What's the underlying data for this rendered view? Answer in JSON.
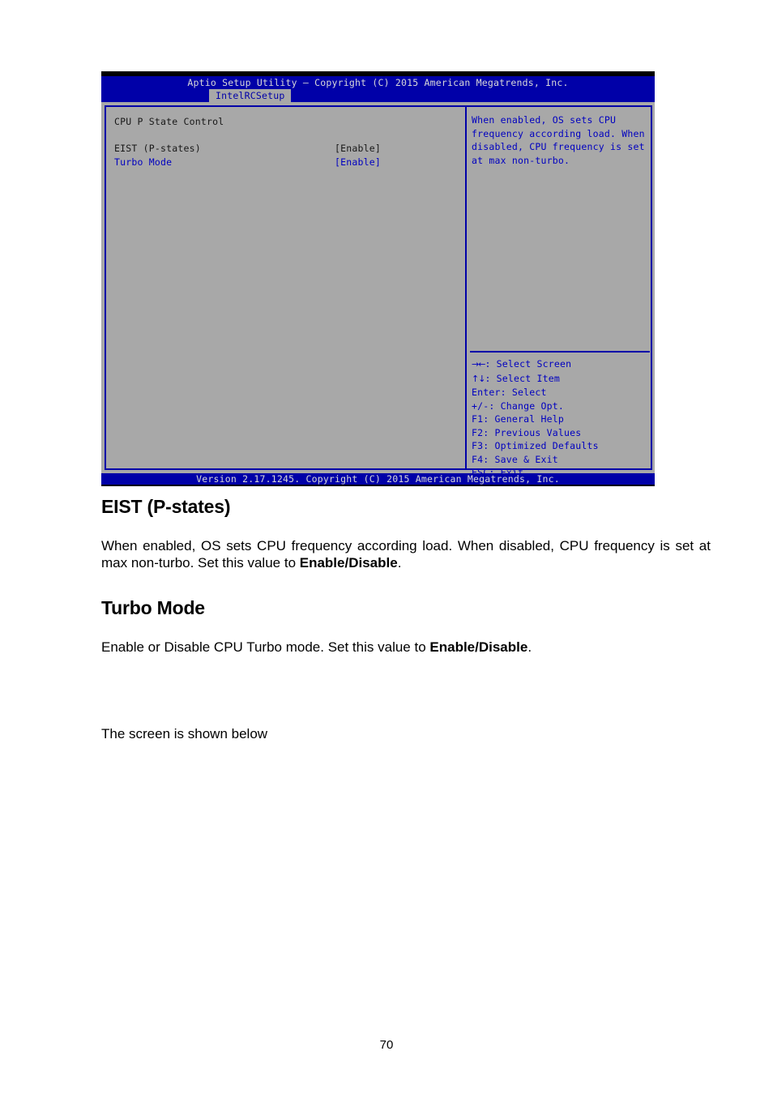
{
  "bios": {
    "title": "Aptio Setup Utility – Copyright (C) 2015 American Megatrends, Inc.",
    "tab": "IntelRCSetup",
    "section_header": "CPU P State Control",
    "options": [
      {
        "label": "EIST (P-states)",
        "value": "[Enable]",
        "selected": false
      },
      {
        "label": "Turbo Mode",
        "value": "[Enable]",
        "selected": true
      }
    ],
    "help_lines": [
      "When enabled, OS sets CPU",
      "frequency according load. When",
      "disabled, CPU frequency is set",
      "at max non-turbo."
    ],
    "keys": [
      {
        "glyph": "→←",
        "text": ": Select Screen"
      },
      {
        "glyph": "↑↓",
        "text": ": Select Item"
      },
      {
        "glyph": "",
        "text": "Enter: Select"
      },
      {
        "glyph": "",
        "text": "+/-: Change Opt."
      },
      {
        "glyph": "",
        "text": "F1: General Help"
      },
      {
        "glyph": "",
        "text": "F2: Previous Values"
      },
      {
        "glyph": "",
        "text": "F3: Optimized Defaults"
      },
      {
        "glyph": "",
        "text": "F4: Save & Exit"
      },
      {
        "glyph": "",
        "text": "ESC: Exit"
      }
    ],
    "footer": "Version 2.17.1245. Copyright (C) 2015 American Megatrends, Inc.",
    "colors": {
      "blue_bg": "#0000a8",
      "gray_bg": "#a8a8a8",
      "text_blue": "#0000c0",
      "text_dark": "#181818",
      "title_text": "#d8d8d8"
    }
  },
  "doc": {
    "section1": {
      "heading": "EIST (P-states)",
      "body_before": "When enabled, OS sets CPU frequency according load. When disabled, CPU frequency is set at max non-turbo. Set this value to ",
      "body_bold": "Enable/Disable",
      "body_after": "."
    },
    "section2": {
      "heading": "Turbo Mode",
      "body_before": "Enable or Disable CPU Turbo mode. Set this value to ",
      "body_bold": "Enable/Disable",
      "body_after": "."
    },
    "trailing_note": "The screen is shown below",
    "page_number": "70"
  }
}
